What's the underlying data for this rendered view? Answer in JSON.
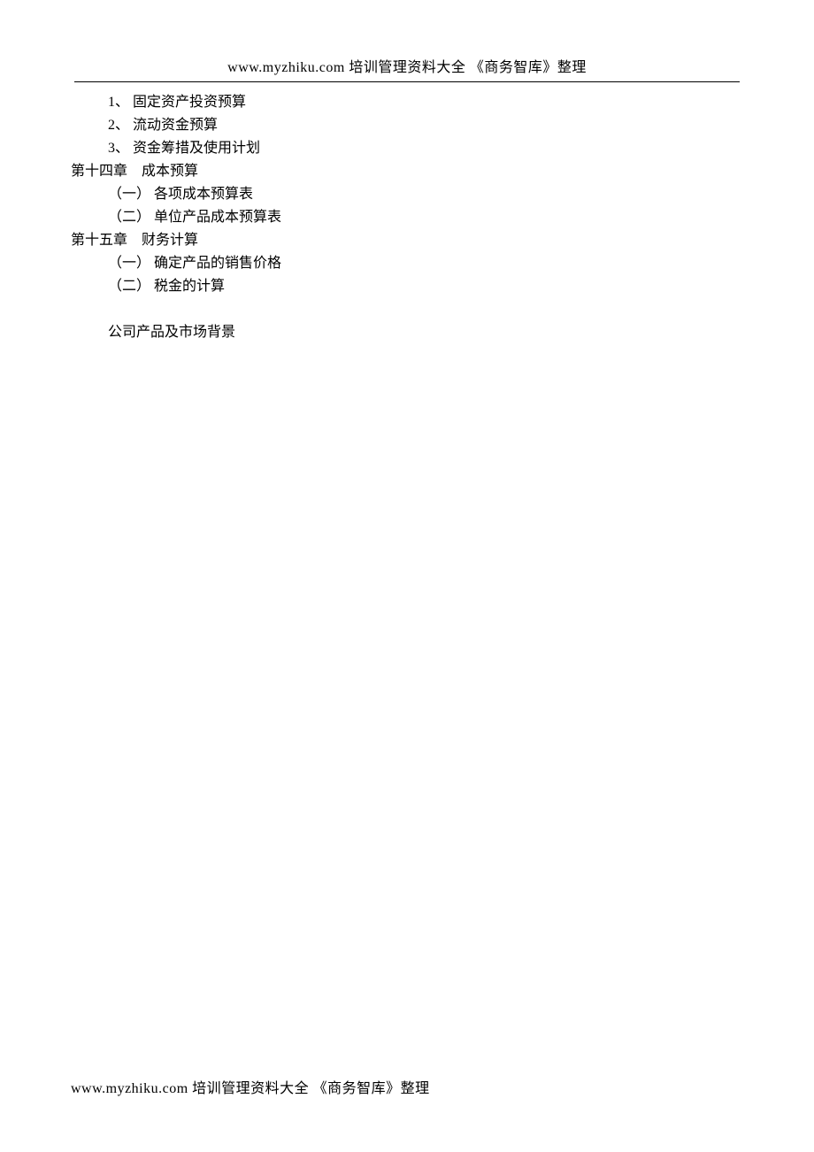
{
  "header": {
    "text": "www.myzhiku.com  培训管理资料大全    《商务智库》整理"
  },
  "content": {
    "items": [
      {
        "indent": "indent-1",
        "text": "1、 固定资产投资预算"
      },
      {
        "indent": "indent-1",
        "text": "2、 流动资金预算"
      },
      {
        "indent": "indent-1",
        "text": "3、 资金筹措及使用计划"
      }
    ],
    "chapter14": {
      "title": "第十四章    成本预算",
      "items": [
        {
          "indent": "indent-2",
          "text": "（一） 各项成本预算表"
        },
        {
          "indent": "indent-2",
          "text": "（二） 单位产品成本预算表"
        }
      ]
    },
    "chapter15": {
      "title": "第十五章    财务计算",
      "items": [
        {
          "indent": "indent-2",
          "text": "（一） 确定产品的销售价格"
        },
        {
          "indent": "indent-2",
          "text": "（二） 税金的计算"
        }
      ]
    },
    "section": "公司产品及市场背景"
  },
  "footer": {
    "text": "www.myzhiku.com  培训管理资料大全    《商务智库》整理"
  }
}
